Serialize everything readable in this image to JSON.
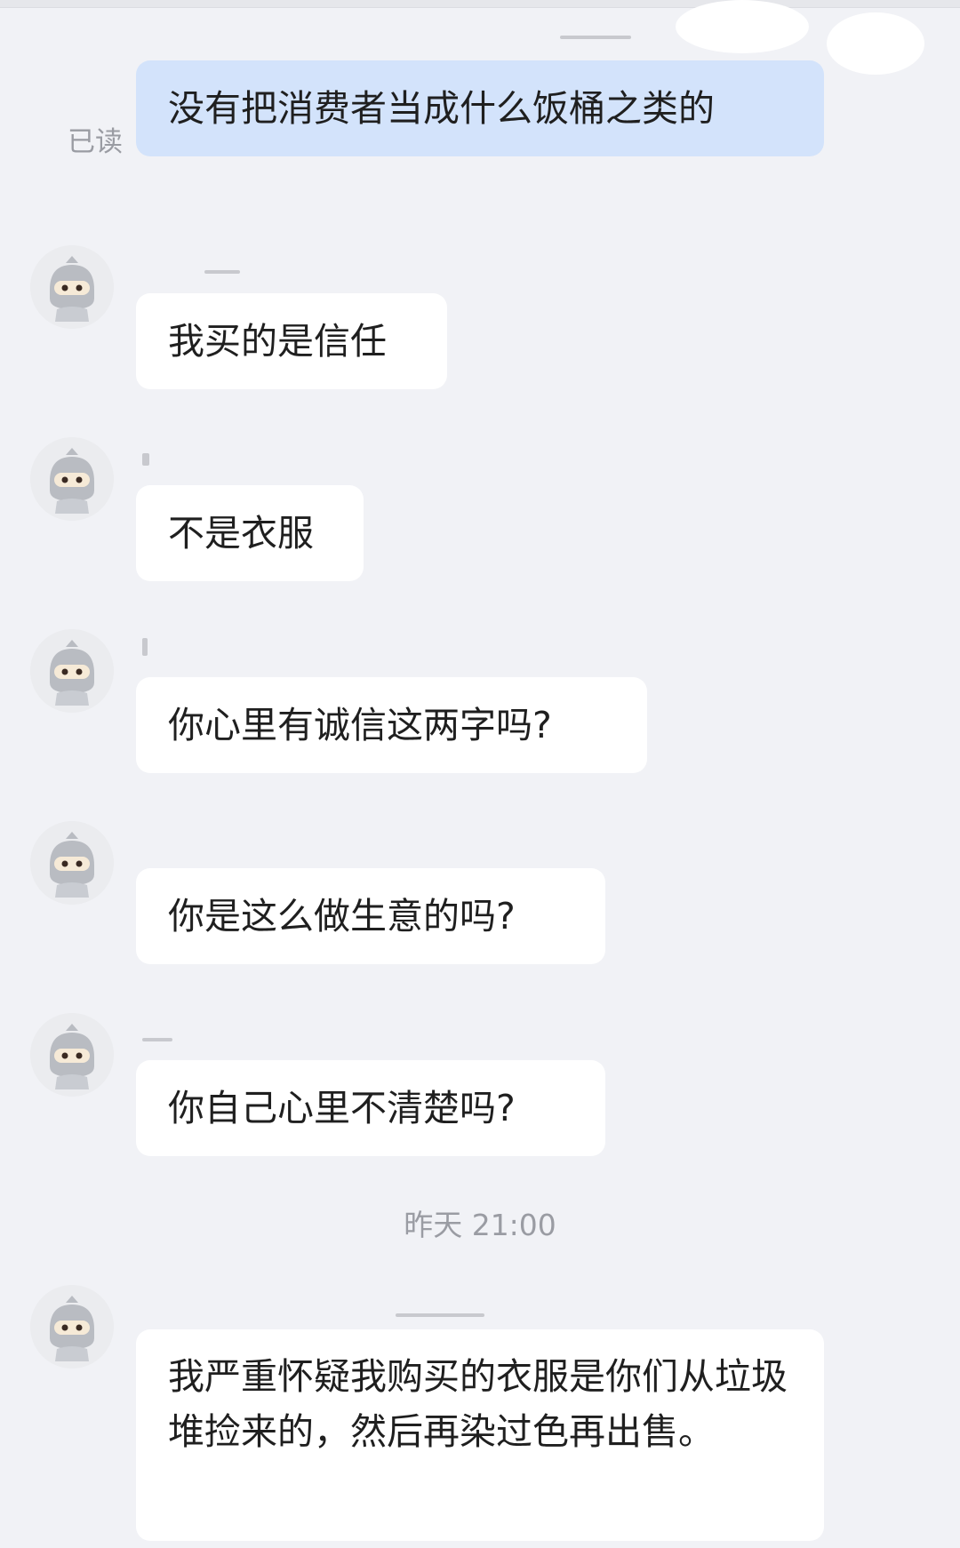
{
  "status": {
    "read_label": "已读"
  },
  "messages": [
    {
      "sender": "self",
      "text": "没有把消费者当成什么饭桶之类的"
    },
    {
      "sender": "other",
      "text": "我买的是信任"
    },
    {
      "sender": "other",
      "text": "不是衣服"
    },
    {
      "sender": "other",
      "text": "你心里有诚信这两字吗?"
    },
    {
      "sender": "other",
      "text": "你是这么做生意的吗?"
    },
    {
      "sender": "other",
      "text": "你自己心里不清楚吗?"
    },
    {
      "sender": "other",
      "text": "我严重怀疑我购买的衣服是你们从垃圾堆捡来的，然后再染过色再出售。"
    }
  ],
  "divider": {
    "timestamp": "昨天 21:00"
  },
  "icons": {
    "avatar": "ninja-avatar-icon"
  },
  "colors": {
    "background": "#f1f2f6",
    "self_bubble": "#d3e3fb",
    "other_bubble": "#ffffff",
    "meta_text": "#9a9ca3"
  }
}
